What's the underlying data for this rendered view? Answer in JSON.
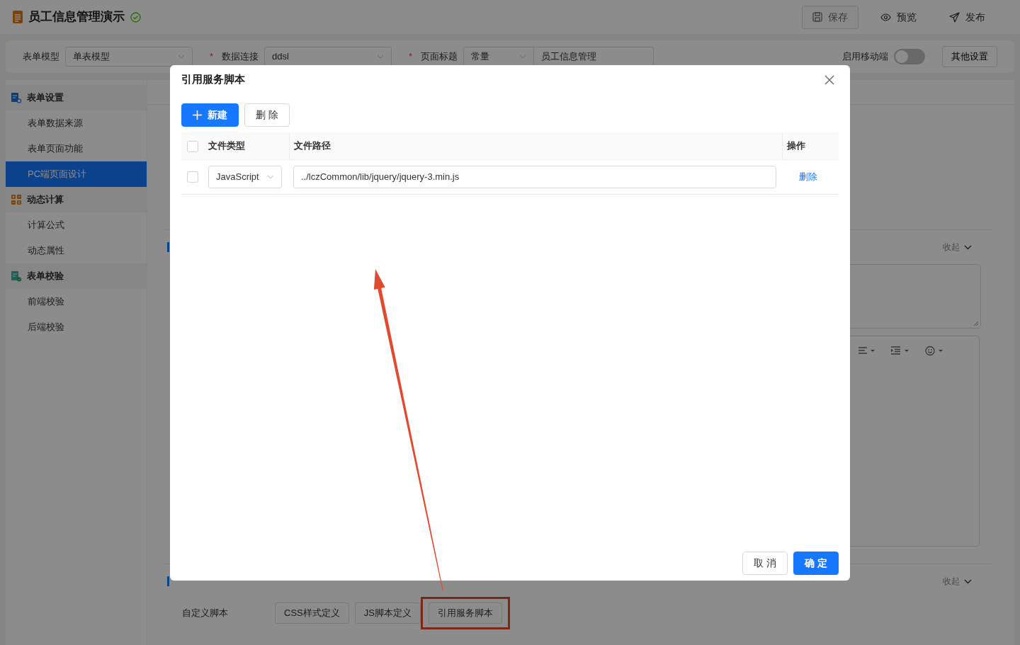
{
  "header": {
    "title": "员工信息管理演示",
    "buttons": [
      {
        "label": "保存",
        "kind": "save",
        "disabled": true
      },
      {
        "label": "预览",
        "kind": "preview",
        "disabled": false
      },
      {
        "label": "发布",
        "kind": "publish",
        "disabled": false
      }
    ]
  },
  "form_bar": {
    "fields": [
      {
        "label": "表单模型",
        "value": "单表模型"
      },
      {
        "label": "数据连接",
        "required_mark": "*",
        "value": "ddsl"
      },
      {
        "label": "页面标题",
        "required_mark": "*",
        "value": "常量",
        "input_value": "员工信息管理"
      }
    ],
    "mobile_switch": {
      "label": "启用移动端",
      "on": false
    },
    "other_button": "其他设置"
  },
  "sidebar": {
    "groups": [
      {
        "title": "表单设置",
        "kind": "form",
        "items": [
          {
            "label": "表单数据来源",
            "selected": false
          },
          {
            "label": "表单页面功能",
            "selected": false
          },
          {
            "label": "PC端页面设计",
            "selected": true
          }
        ]
      },
      {
        "title": "动态计算",
        "kind": "calc",
        "items": [
          {
            "label": "计算公式",
            "selected": false
          },
          {
            "label": "动态属性",
            "selected": false
          }
        ]
      },
      {
        "title": "表单校验",
        "kind": "check",
        "items": [
          {
            "label": "前端校验",
            "selected": false
          },
          {
            "label": "后端校验",
            "selected": false
          }
        ]
      }
    ]
  },
  "main": {
    "section": {
      "collapse": "收起"
    },
    "advanced": {
      "collapse": "收起",
      "row_label": "自定义脚本",
      "buttons": [
        {
          "label": "CSS样式定义",
          "highlighted": false
        },
        {
          "label": "JS脚本定义",
          "highlighted": false
        },
        {
          "label": "引用服务脚本",
          "highlighted": true
        }
      ]
    }
  },
  "dialog": {
    "title": "引用服务脚本",
    "toolbar_buttons": [
      {
        "label": "新建",
        "kind": "primary"
      },
      {
        "label": "删 除",
        "kind": "default"
      }
    ],
    "table": {
      "all_checked": false,
      "columns": [
        "文件类型",
        "文件路径",
        "操作"
      ],
      "rows": [
        {
          "checked": false,
          "file_type": "JavaScript",
          "path": "../lczCommon/lib/jquery/jquery-3.min.js",
          "action": "删除"
        }
      ]
    },
    "footer_buttons": [
      {
        "label": "取 消",
        "kind": "default"
      },
      {
        "label": "确 定",
        "kind": "primary"
      }
    ]
  }
}
